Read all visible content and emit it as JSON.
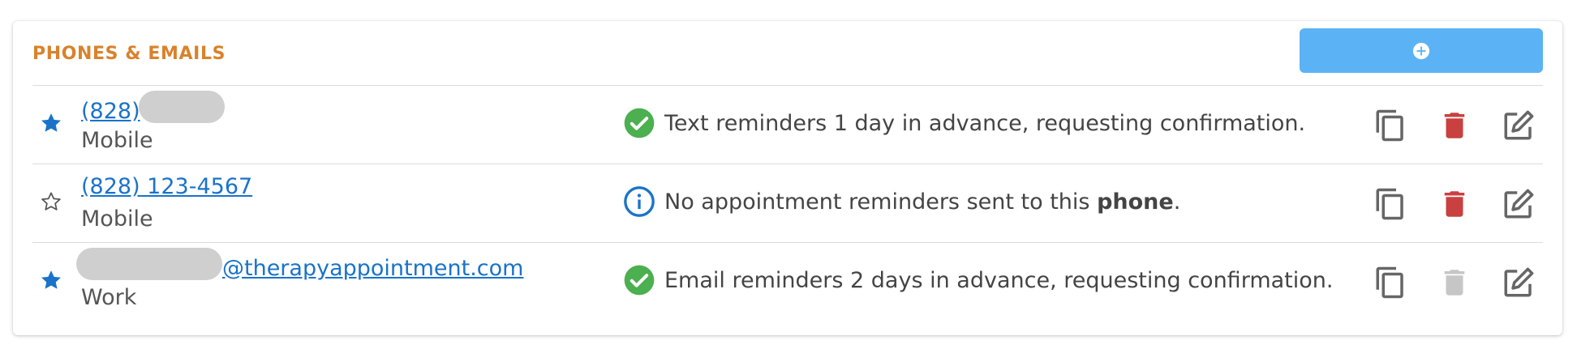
{
  "section": {
    "title": "PHONES & EMAILS"
  },
  "colors": {
    "accent": "#d9822b",
    "button": "#5bb3f5",
    "link": "#1a73c9",
    "success": "#4caf50",
    "info": "#1a73c9",
    "delete": "#c94040",
    "delete_disabled": "#c6c6c6"
  },
  "add_button": {
    "icon": "plus-circle-icon"
  },
  "contacts": [
    {
      "primary": true,
      "value_visible": "(828)",
      "redacted": true,
      "type": "Mobile",
      "status_icon": "check-circle-icon",
      "status_text": "Text reminders 1 day in advance, requesting confirmation.",
      "delete_enabled": true
    },
    {
      "primary": false,
      "value_visible": "(828) 123-4567",
      "redacted": false,
      "type": "Mobile",
      "status_icon": "info-circle-icon",
      "status_prefix": "No appointment reminders sent to this ",
      "status_bold": "phone",
      "status_suffix": ".",
      "delete_enabled": true
    },
    {
      "primary": true,
      "value_visible": "@therapyappointment.com",
      "redacted": true,
      "type": "Work",
      "status_icon": "check-circle-icon",
      "status_text": "Email reminders 2 days in advance, requesting confirmation.",
      "delete_enabled": false
    }
  ]
}
